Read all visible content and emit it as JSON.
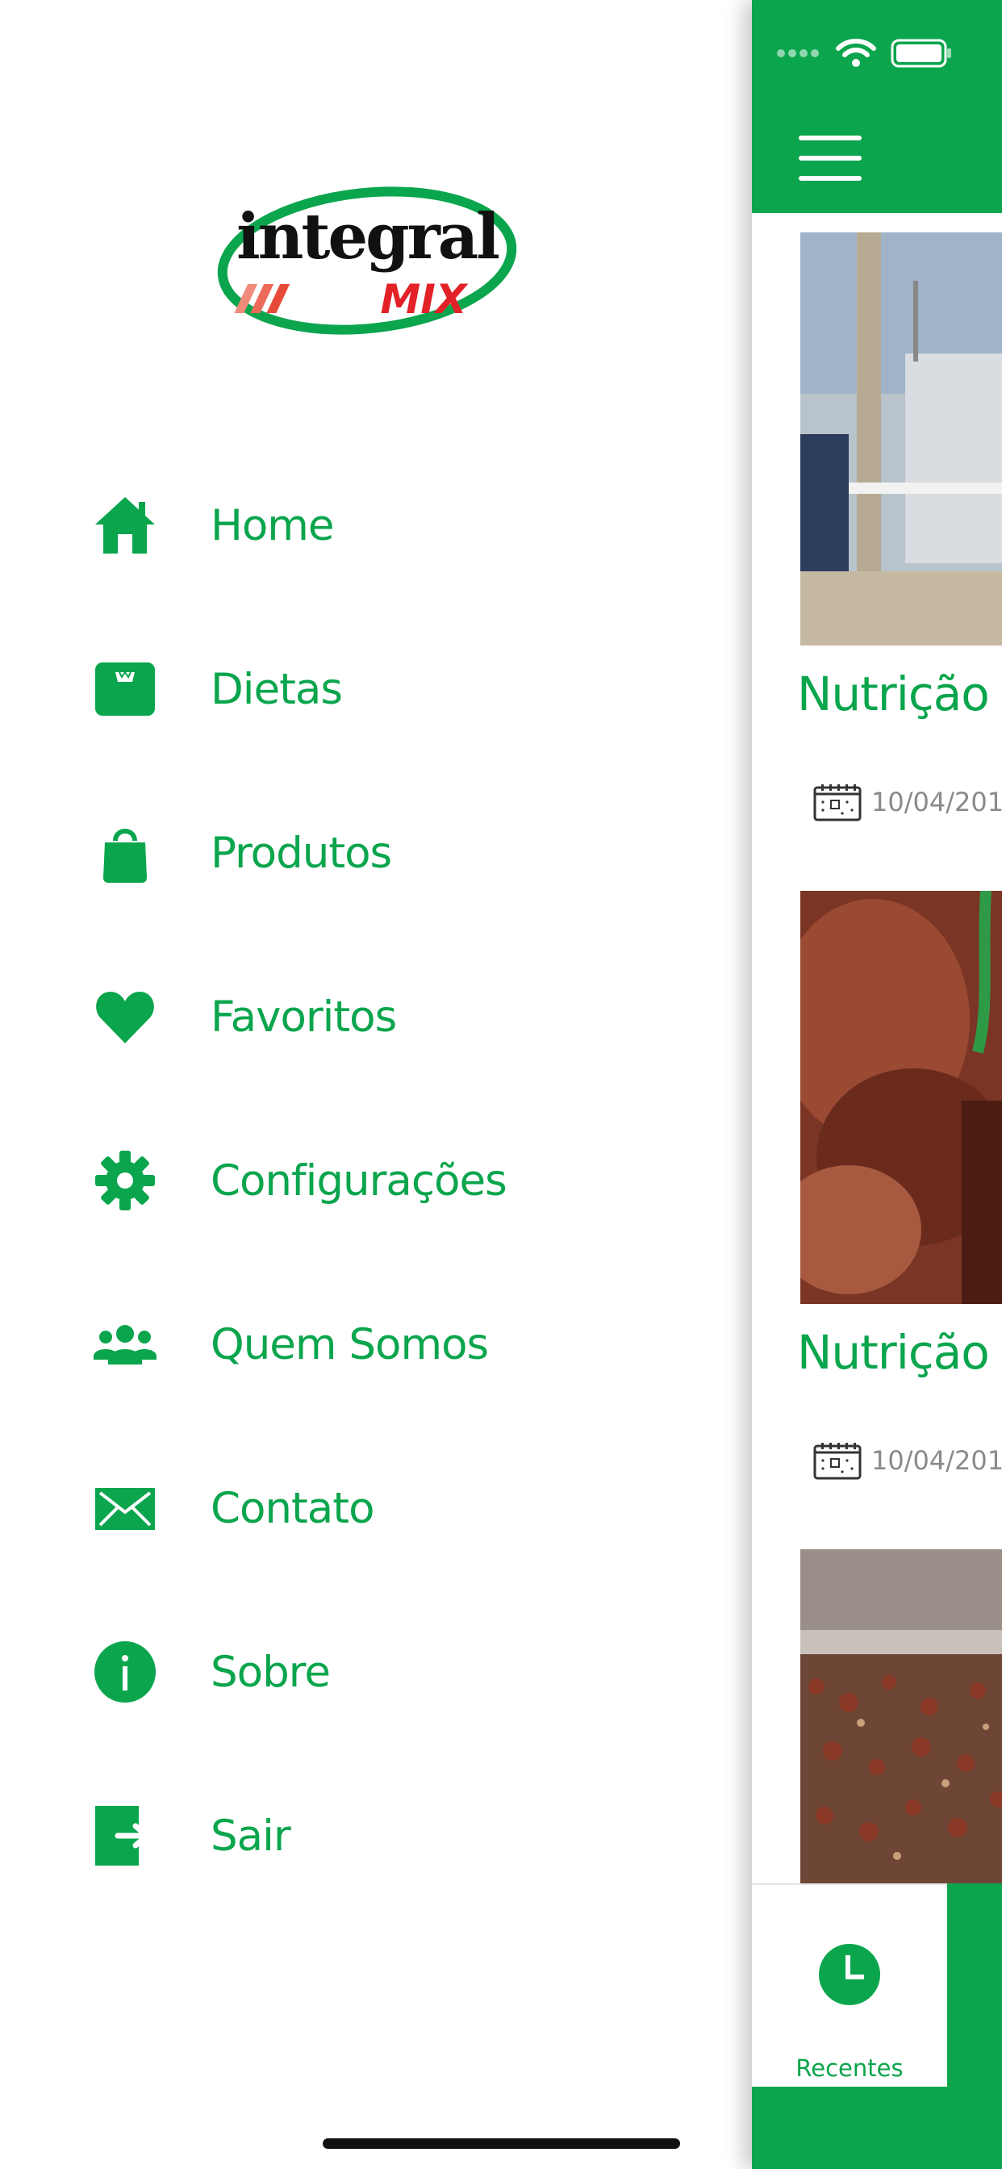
{
  "drawer": {
    "logo": {
      "word": "integral",
      "sub": "MIX"
    },
    "items": [
      {
        "label": "Home",
        "icon": "home-icon"
      },
      {
        "label": "Dietas",
        "icon": "scale-icon"
      },
      {
        "label": "Produtos",
        "icon": "shopping-bag-icon"
      },
      {
        "label": "Favoritos",
        "icon": "heart-icon"
      },
      {
        "label": "Configurações",
        "icon": "gear-icon"
      },
      {
        "label": "Quem Somos",
        "icon": "group-icon"
      },
      {
        "label": "Contato",
        "icon": "mail-icon"
      },
      {
        "label": "Sobre",
        "icon": "info-icon"
      },
      {
        "label": "Sair",
        "icon": "logout-icon"
      }
    ]
  },
  "panel": {
    "cards": [
      {
        "title": "Nutrição",
        "date": "10/04/201"
      },
      {
        "title": "Nutrição",
        "date": "10/04/201"
      },
      {
        "title": "",
        "date": ""
      }
    ],
    "tab": {
      "label": "Recentes",
      "icon": "clock-icon"
    }
  },
  "colors": {
    "brand_green": "#0aa54c",
    "logo_red": "#e32228",
    "date_gray": "#8a8a8a"
  }
}
